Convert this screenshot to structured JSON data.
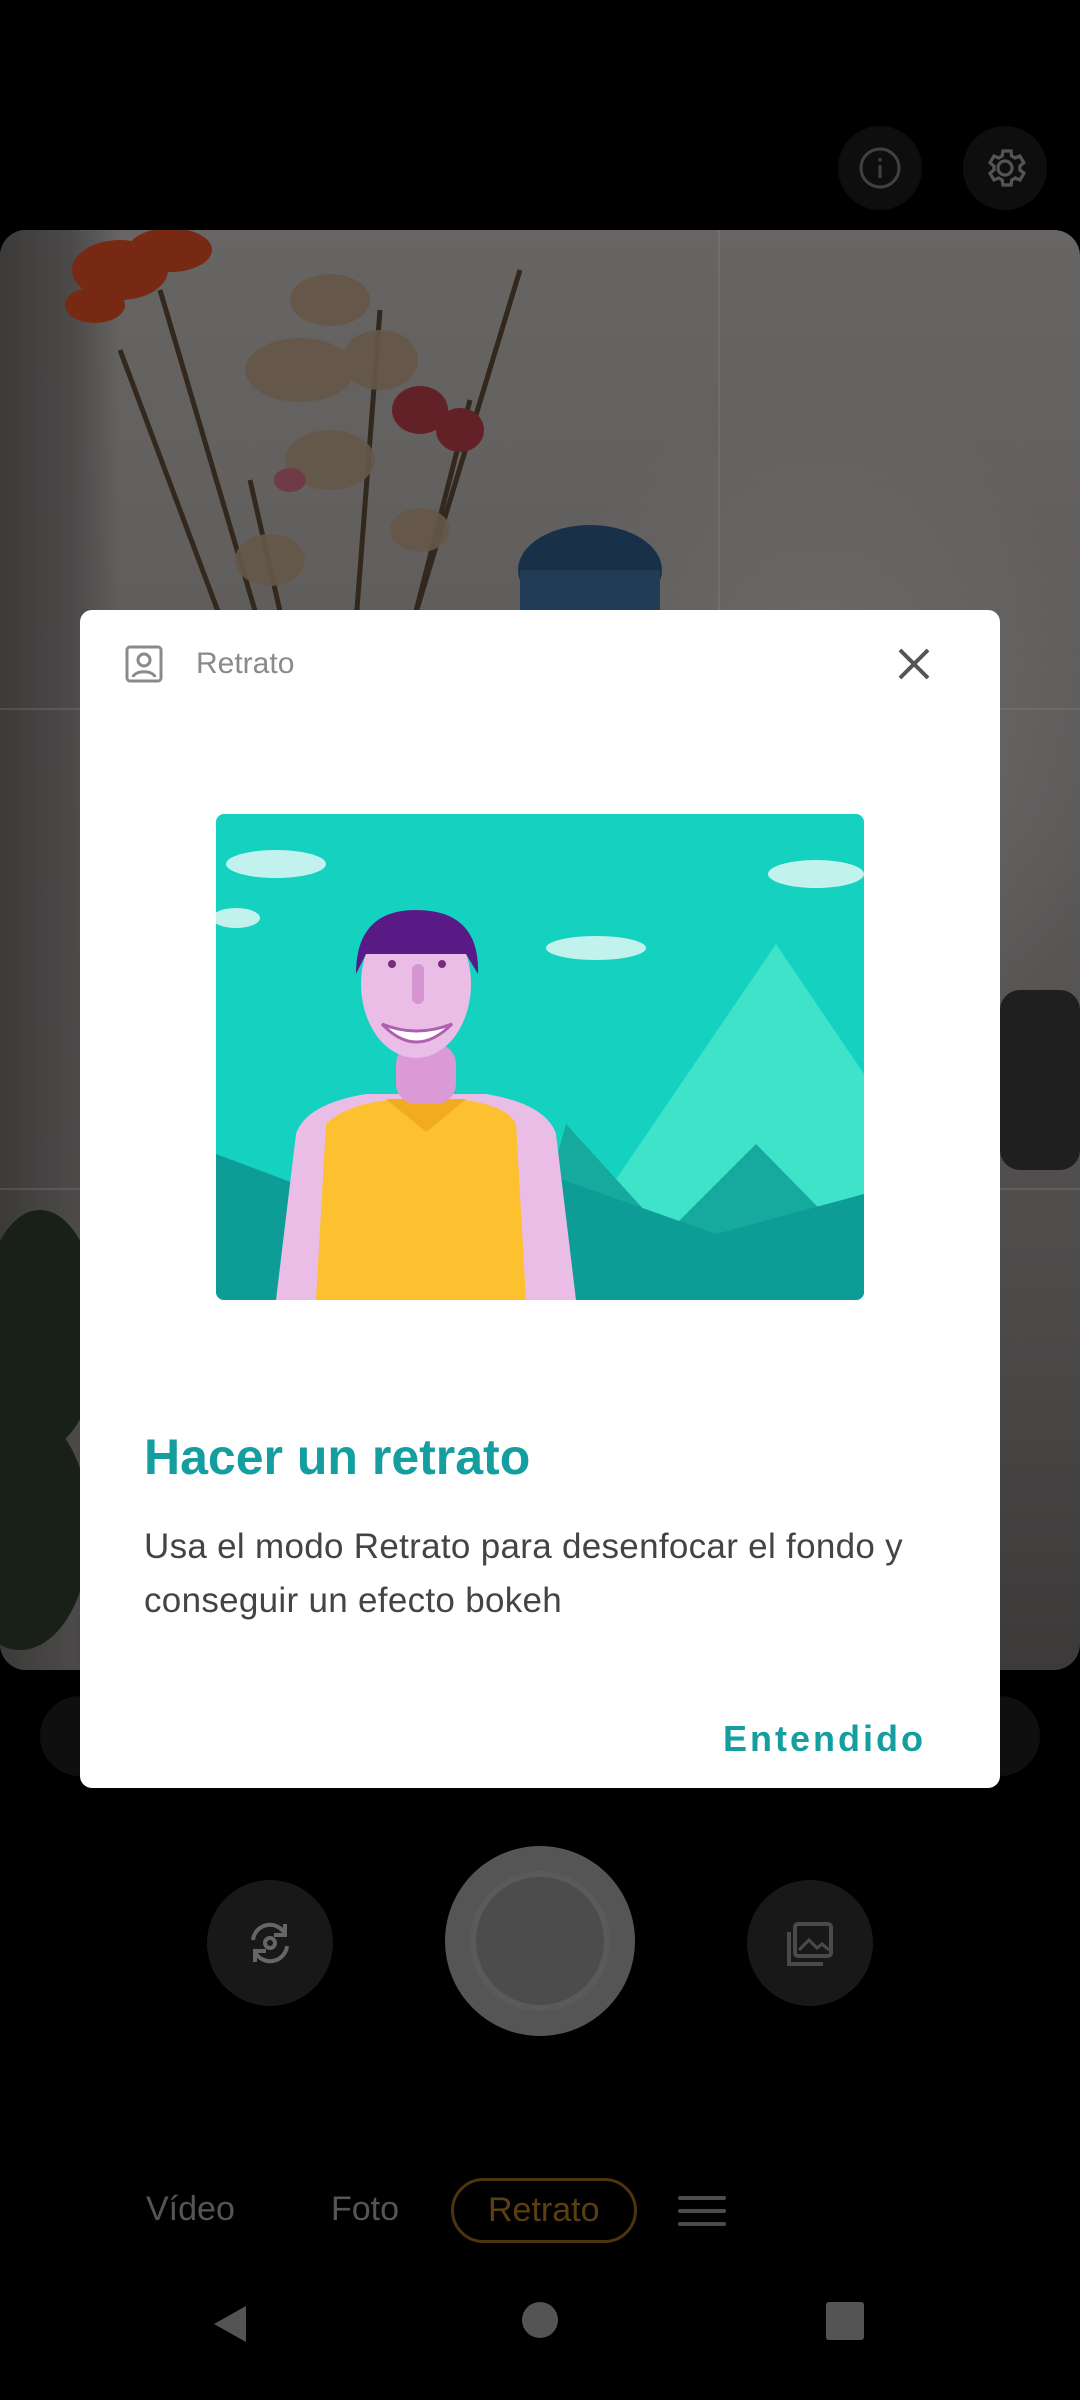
{
  "top_bar": {
    "info_icon": "info-icon",
    "settings_icon": "gear-icon"
  },
  "dialog": {
    "header_icon": "portrait-icon",
    "header_title": "Retrato",
    "close_icon": "close-icon",
    "title": "Hacer un retrato",
    "body": "Usa el modo Retrato para desenfocar el fondo y conseguir un efecto bokeh",
    "confirm_label": "Entendido"
  },
  "controls": {
    "switch_camera_icon": "switch-camera-icon",
    "shutter_icon": "shutter-button",
    "gallery_icon": "gallery-icon"
  },
  "modes": {
    "video": "Vídeo",
    "photo": "Foto",
    "portrait": "Retrato",
    "more_icon": "menu-icon"
  },
  "nav": {
    "back_icon": "back-icon",
    "home_icon": "home-icon",
    "recents_icon": "recents-icon"
  },
  "colors": {
    "accent": "#159ea0",
    "active_mode": "#a4741e"
  }
}
